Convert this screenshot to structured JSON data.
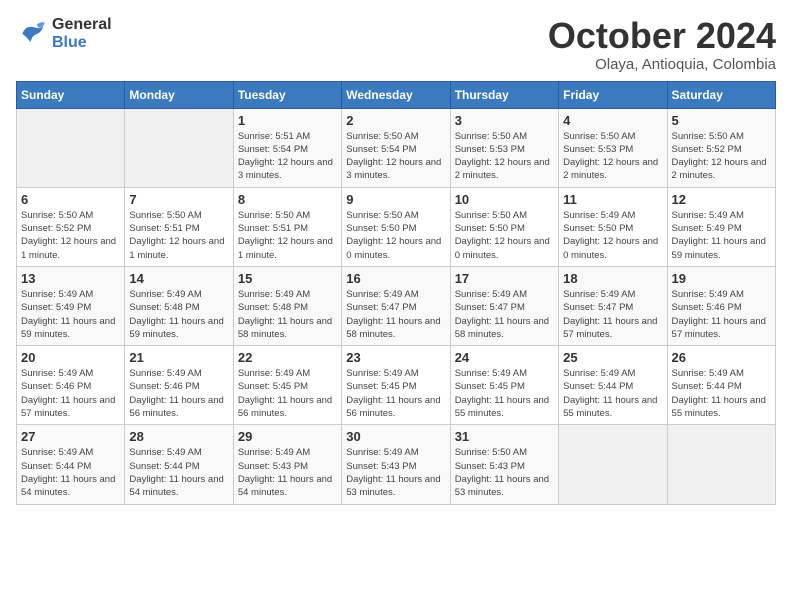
{
  "logo": {
    "line1": "General",
    "line2": "Blue"
  },
  "title": "October 2024",
  "subtitle": "Olaya, Antioquia, Colombia",
  "days_header": [
    "Sunday",
    "Monday",
    "Tuesday",
    "Wednesday",
    "Thursday",
    "Friday",
    "Saturday"
  ],
  "weeks": [
    [
      {
        "day": "",
        "info": ""
      },
      {
        "day": "",
        "info": ""
      },
      {
        "day": "1",
        "info": "Sunrise: 5:51 AM\nSunset: 5:54 PM\nDaylight: 12 hours and 3 minutes."
      },
      {
        "day": "2",
        "info": "Sunrise: 5:50 AM\nSunset: 5:54 PM\nDaylight: 12 hours and 3 minutes."
      },
      {
        "day": "3",
        "info": "Sunrise: 5:50 AM\nSunset: 5:53 PM\nDaylight: 12 hours and 2 minutes."
      },
      {
        "day": "4",
        "info": "Sunrise: 5:50 AM\nSunset: 5:53 PM\nDaylight: 12 hours and 2 minutes."
      },
      {
        "day": "5",
        "info": "Sunrise: 5:50 AM\nSunset: 5:52 PM\nDaylight: 12 hours and 2 minutes."
      }
    ],
    [
      {
        "day": "6",
        "info": "Sunrise: 5:50 AM\nSunset: 5:52 PM\nDaylight: 12 hours and 1 minute."
      },
      {
        "day": "7",
        "info": "Sunrise: 5:50 AM\nSunset: 5:51 PM\nDaylight: 12 hours and 1 minute."
      },
      {
        "day": "8",
        "info": "Sunrise: 5:50 AM\nSunset: 5:51 PM\nDaylight: 12 hours and 1 minute."
      },
      {
        "day": "9",
        "info": "Sunrise: 5:50 AM\nSunset: 5:50 PM\nDaylight: 12 hours and 0 minutes."
      },
      {
        "day": "10",
        "info": "Sunrise: 5:50 AM\nSunset: 5:50 PM\nDaylight: 12 hours and 0 minutes."
      },
      {
        "day": "11",
        "info": "Sunrise: 5:49 AM\nSunset: 5:50 PM\nDaylight: 12 hours and 0 minutes."
      },
      {
        "day": "12",
        "info": "Sunrise: 5:49 AM\nSunset: 5:49 PM\nDaylight: 11 hours and 59 minutes."
      }
    ],
    [
      {
        "day": "13",
        "info": "Sunrise: 5:49 AM\nSunset: 5:49 PM\nDaylight: 11 hours and 59 minutes."
      },
      {
        "day": "14",
        "info": "Sunrise: 5:49 AM\nSunset: 5:48 PM\nDaylight: 11 hours and 59 minutes."
      },
      {
        "day": "15",
        "info": "Sunrise: 5:49 AM\nSunset: 5:48 PM\nDaylight: 11 hours and 58 minutes."
      },
      {
        "day": "16",
        "info": "Sunrise: 5:49 AM\nSunset: 5:47 PM\nDaylight: 11 hours and 58 minutes."
      },
      {
        "day": "17",
        "info": "Sunrise: 5:49 AM\nSunset: 5:47 PM\nDaylight: 11 hours and 58 minutes."
      },
      {
        "day": "18",
        "info": "Sunrise: 5:49 AM\nSunset: 5:47 PM\nDaylight: 11 hours and 57 minutes."
      },
      {
        "day": "19",
        "info": "Sunrise: 5:49 AM\nSunset: 5:46 PM\nDaylight: 11 hours and 57 minutes."
      }
    ],
    [
      {
        "day": "20",
        "info": "Sunrise: 5:49 AM\nSunset: 5:46 PM\nDaylight: 11 hours and 57 minutes."
      },
      {
        "day": "21",
        "info": "Sunrise: 5:49 AM\nSunset: 5:46 PM\nDaylight: 11 hours and 56 minutes."
      },
      {
        "day": "22",
        "info": "Sunrise: 5:49 AM\nSunset: 5:45 PM\nDaylight: 11 hours and 56 minutes."
      },
      {
        "day": "23",
        "info": "Sunrise: 5:49 AM\nSunset: 5:45 PM\nDaylight: 11 hours and 56 minutes."
      },
      {
        "day": "24",
        "info": "Sunrise: 5:49 AM\nSunset: 5:45 PM\nDaylight: 11 hours and 55 minutes."
      },
      {
        "day": "25",
        "info": "Sunrise: 5:49 AM\nSunset: 5:44 PM\nDaylight: 11 hours and 55 minutes."
      },
      {
        "day": "26",
        "info": "Sunrise: 5:49 AM\nSunset: 5:44 PM\nDaylight: 11 hours and 55 minutes."
      }
    ],
    [
      {
        "day": "27",
        "info": "Sunrise: 5:49 AM\nSunset: 5:44 PM\nDaylight: 11 hours and 54 minutes."
      },
      {
        "day": "28",
        "info": "Sunrise: 5:49 AM\nSunset: 5:44 PM\nDaylight: 11 hours and 54 minutes."
      },
      {
        "day": "29",
        "info": "Sunrise: 5:49 AM\nSunset: 5:43 PM\nDaylight: 11 hours and 54 minutes."
      },
      {
        "day": "30",
        "info": "Sunrise: 5:49 AM\nSunset: 5:43 PM\nDaylight: 11 hours and 53 minutes."
      },
      {
        "day": "31",
        "info": "Sunrise: 5:50 AM\nSunset: 5:43 PM\nDaylight: 11 hours and 53 minutes."
      },
      {
        "day": "",
        "info": ""
      },
      {
        "day": "",
        "info": ""
      }
    ]
  ]
}
